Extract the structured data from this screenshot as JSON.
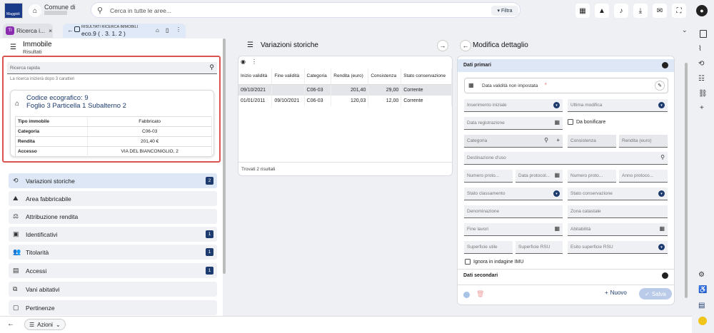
{
  "header": {
    "logo_text": "Maggioli",
    "comune_label": "Comune di",
    "search_placeholder": "Cerca in tutte le aree...",
    "filter_label": "Filtra"
  },
  "tabs": [
    {
      "label": "Ricerca i..."
    },
    {
      "sub": "RISULTATI RICERCA IMMOBILI",
      "main": "eco.9 ( . 3. 1. 2 )"
    }
  ],
  "left": {
    "title": "Immobile",
    "subtitle": "Risultati",
    "quick_search_placeholder": "Ricerca rapida",
    "hint": "La ricerca inizierà dopo 3 caratteri",
    "card": {
      "code": "Codice ecografico: 9",
      "address": "Foglio 3 Particella 1 Subalterno 2",
      "rows": [
        [
          "Tipo immobile",
          "Fabbricato"
        ],
        [
          "Categoria",
          "C06-03"
        ],
        [
          "Rendita",
          "201,40 €"
        ],
        [
          "Accesso",
          "VIA DEL BIANCONIGLIO, 2"
        ]
      ]
    },
    "nav": [
      {
        "label": "Variazioni storiche",
        "badge": "2"
      },
      {
        "label": "Area fabbricabile",
        "badge": ""
      },
      {
        "label": "Attribuzione rendita",
        "badge": ""
      },
      {
        "label": "Identificativi",
        "badge": "1"
      },
      {
        "label": "Titolarità",
        "badge": "1"
      },
      {
        "label": "Accessi",
        "badge": "1"
      },
      {
        "label": "Vani abitativi",
        "badge": ""
      },
      {
        "label": "Pertinenze",
        "badge": ""
      }
    ]
  },
  "middle": {
    "title": "Variazioni storiche",
    "columns": [
      "Inizio validità",
      "Fine validità",
      "Categoria",
      "Rendita (euro)",
      "Consistenza",
      "Stato conservazione"
    ],
    "rows": [
      [
        "09/10/2021",
        "",
        "C06-03",
        "201,40",
        "29,00",
        "Corrente"
      ],
      [
        "01/01/2011",
        "09/10/2021",
        "C06-03",
        "120,03",
        "12,00",
        "Corrente"
      ]
    ],
    "footer": "Trovati 2 risultati"
  },
  "right": {
    "title": "Modifica dettaglio",
    "section1": "Dati primari",
    "section2": "Dati secondari",
    "validity": "Data validità non impostata",
    "fields": {
      "inserimento": "Inserimento iniziale",
      "ultima": "Ultima modifica",
      "registrazione": "Data registrazione",
      "bonificare": "Da bonificare",
      "categoria": "Categoria",
      "consistenza": "Consistenza",
      "rendita": "Rendita (euro)",
      "destinazione": "Destinazione d'uso",
      "numproto1": "Numero proto...",
      "dataproto": "Data protocol...",
      "numproto2": "Numero proto...",
      "annoproto": "Anno protoco...",
      "statoclass": "Stato classamento",
      "statocons": "Stato conservazione",
      "denominazione": "Denominazione",
      "zona": "Zona catastale",
      "finelavori": "Fine lavori",
      "abitabilita": "Abitabilità",
      "superficie": "Superficie utile",
      "supRSU": "Superficie RSU",
      "esito": "Esito superficie RSU",
      "ignora": "Ignora in indagine IMU"
    },
    "nuovo": "Nuovo",
    "salva": "Salva"
  },
  "bottom": {
    "azioni": "Azioni"
  }
}
